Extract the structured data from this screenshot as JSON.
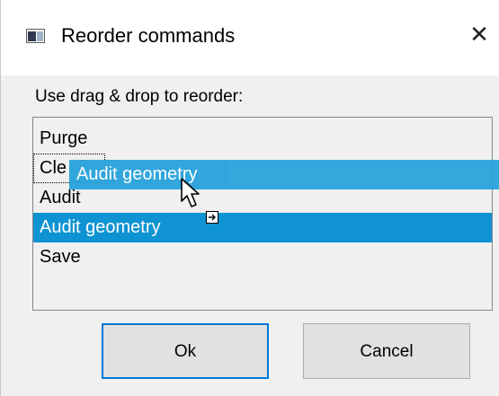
{
  "window": {
    "title": "Reorder commands",
    "close_glyph": "✕"
  },
  "instruction": "Use drag & drop to reorder:",
  "list": {
    "items": [
      {
        "label": "Purge"
      },
      {
        "label": "Cle"
      },
      {
        "label": "Audit"
      },
      {
        "label": "Audit geometry"
      },
      {
        "label": "Save"
      }
    ],
    "selected_index": 3,
    "focused_index": 1
  },
  "drag": {
    "ghost_label": "Audit geometry"
  },
  "buttons": {
    "ok": "Ok",
    "cancel": "Cancel"
  },
  "colors": {
    "selection": "#0f93d2",
    "drag_ghost": "#27a3db",
    "default_button_border": "#0078d7"
  }
}
